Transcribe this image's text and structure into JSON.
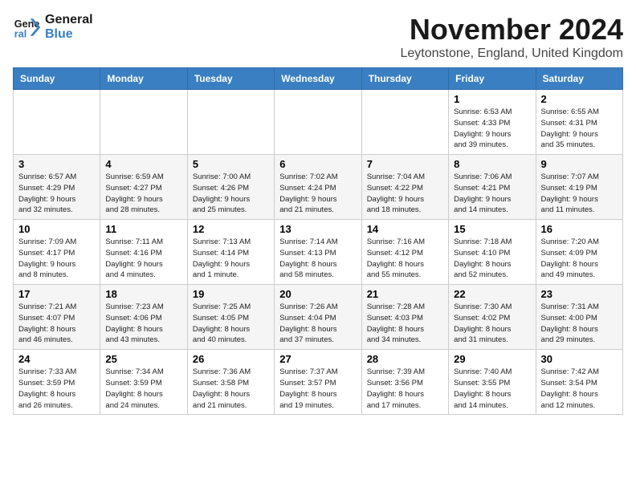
{
  "header": {
    "logo_line1": "General",
    "logo_line2": "Blue",
    "month": "November 2024",
    "location": "Leytonstone, England, United Kingdom"
  },
  "weekdays": [
    "Sunday",
    "Monday",
    "Tuesday",
    "Wednesday",
    "Thursday",
    "Friday",
    "Saturday"
  ],
  "weeks": [
    [
      {
        "day": "",
        "info": ""
      },
      {
        "day": "",
        "info": ""
      },
      {
        "day": "",
        "info": ""
      },
      {
        "day": "",
        "info": ""
      },
      {
        "day": "",
        "info": ""
      },
      {
        "day": "1",
        "info": "Sunrise: 6:53 AM\nSunset: 4:33 PM\nDaylight: 9 hours\nand 39 minutes."
      },
      {
        "day": "2",
        "info": "Sunrise: 6:55 AM\nSunset: 4:31 PM\nDaylight: 9 hours\nand 35 minutes."
      }
    ],
    [
      {
        "day": "3",
        "info": "Sunrise: 6:57 AM\nSunset: 4:29 PM\nDaylight: 9 hours\nand 32 minutes."
      },
      {
        "day": "4",
        "info": "Sunrise: 6:59 AM\nSunset: 4:27 PM\nDaylight: 9 hours\nand 28 minutes."
      },
      {
        "day": "5",
        "info": "Sunrise: 7:00 AM\nSunset: 4:26 PM\nDaylight: 9 hours\nand 25 minutes."
      },
      {
        "day": "6",
        "info": "Sunrise: 7:02 AM\nSunset: 4:24 PM\nDaylight: 9 hours\nand 21 minutes."
      },
      {
        "day": "7",
        "info": "Sunrise: 7:04 AM\nSunset: 4:22 PM\nDaylight: 9 hours\nand 18 minutes."
      },
      {
        "day": "8",
        "info": "Sunrise: 7:06 AM\nSunset: 4:21 PM\nDaylight: 9 hours\nand 14 minutes."
      },
      {
        "day": "9",
        "info": "Sunrise: 7:07 AM\nSunset: 4:19 PM\nDaylight: 9 hours\nand 11 minutes."
      }
    ],
    [
      {
        "day": "10",
        "info": "Sunrise: 7:09 AM\nSunset: 4:17 PM\nDaylight: 9 hours\nand 8 minutes."
      },
      {
        "day": "11",
        "info": "Sunrise: 7:11 AM\nSunset: 4:16 PM\nDaylight: 9 hours\nand 4 minutes."
      },
      {
        "day": "12",
        "info": "Sunrise: 7:13 AM\nSunset: 4:14 PM\nDaylight: 9 hours\nand 1 minute."
      },
      {
        "day": "13",
        "info": "Sunrise: 7:14 AM\nSunset: 4:13 PM\nDaylight: 8 hours\nand 58 minutes."
      },
      {
        "day": "14",
        "info": "Sunrise: 7:16 AM\nSunset: 4:12 PM\nDaylight: 8 hours\nand 55 minutes."
      },
      {
        "day": "15",
        "info": "Sunrise: 7:18 AM\nSunset: 4:10 PM\nDaylight: 8 hours\nand 52 minutes."
      },
      {
        "day": "16",
        "info": "Sunrise: 7:20 AM\nSunset: 4:09 PM\nDaylight: 8 hours\nand 49 minutes."
      }
    ],
    [
      {
        "day": "17",
        "info": "Sunrise: 7:21 AM\nSunset: 4:07 PM\nDaylight: 8 hours\nand 46 minutes."
      },
      {
        "day": "18",
        "info": "Sunrise: 7:23 AM\nSunset: 4:06 PM\nDaylight: 8 hours\nand 43 minutes."
      },
      {
        "day": "19",
        "info": "Sunrise: 7:25 AM\nSunset: 4:05 PM\nDaylight: 8 hours\nand 40 minutes."
      },
      {
        "day": "20",
        "info": "Sunrise: 7:26 AM\nSunset: 4:04 PM\nDaylight: 8 hours\nand 37 minutes."
      },
      {
        "day": "21",
        "info": "Sunrise: 7:28 AM\nSunset: 4:03 PM\nDaylight: 8 hours\nand 34 minutes."
      },
      {
        "day": "22",
        "info": "Sunrise: 7:30 AM\nSunset: 4:02 PM\nDaylight: 8 hours\nand 31 minutes."
      },
      {
        "day": "23",
        "info": "Sunrise: 7:31 AM\nSunset: 4:00 PM\nDaylight: 8 hours\nand 29 minutes."
      }
    ],
    [
      {
        "day": "24",
        "info": "Sunrise: 7:33 AM\nSunset: 3:59 PM\nDaylight: 8 hours\nand 26 minutes."
      },
      {
        "day": "25",
        "info": "Sunrise: 7:34 AM\nSunset: 3:59 PM\nDaylight: 8 hours\nand 24 minutes."
      },
      {
        "day": "26",
        "info": "Sunrise: 7:36 AM\nSunset: 3:58 PM\nDaylight: 8 hours\nand 21 minutes."
      },
      {
        "day": "27",
        "info": "Sunrise: 7:37 AM\nSunset: 3:57 PM\nDaylight: 8 hours\nand 19 minutes."
      },
      {
        "day": "28",
        "info": "Sunrise: 7:39 AM\nSunset: 3:56 PM\nDaylight: 8 hours\nand 17 minutes."
      },
      {
        "day": "29",
        "info": "Sunrise: 7:40 AM\nSunset: 3:55 PM\nDaylight: 8 hours\nand 14 minutes."
      },
      {
        "day": "30",
        "info": "Sunrise: 7:42 AM\nSunset: 3:54 PM\nDaylight: 8 hours\nand 12 minutes."
      }
    ]
  ]
}
